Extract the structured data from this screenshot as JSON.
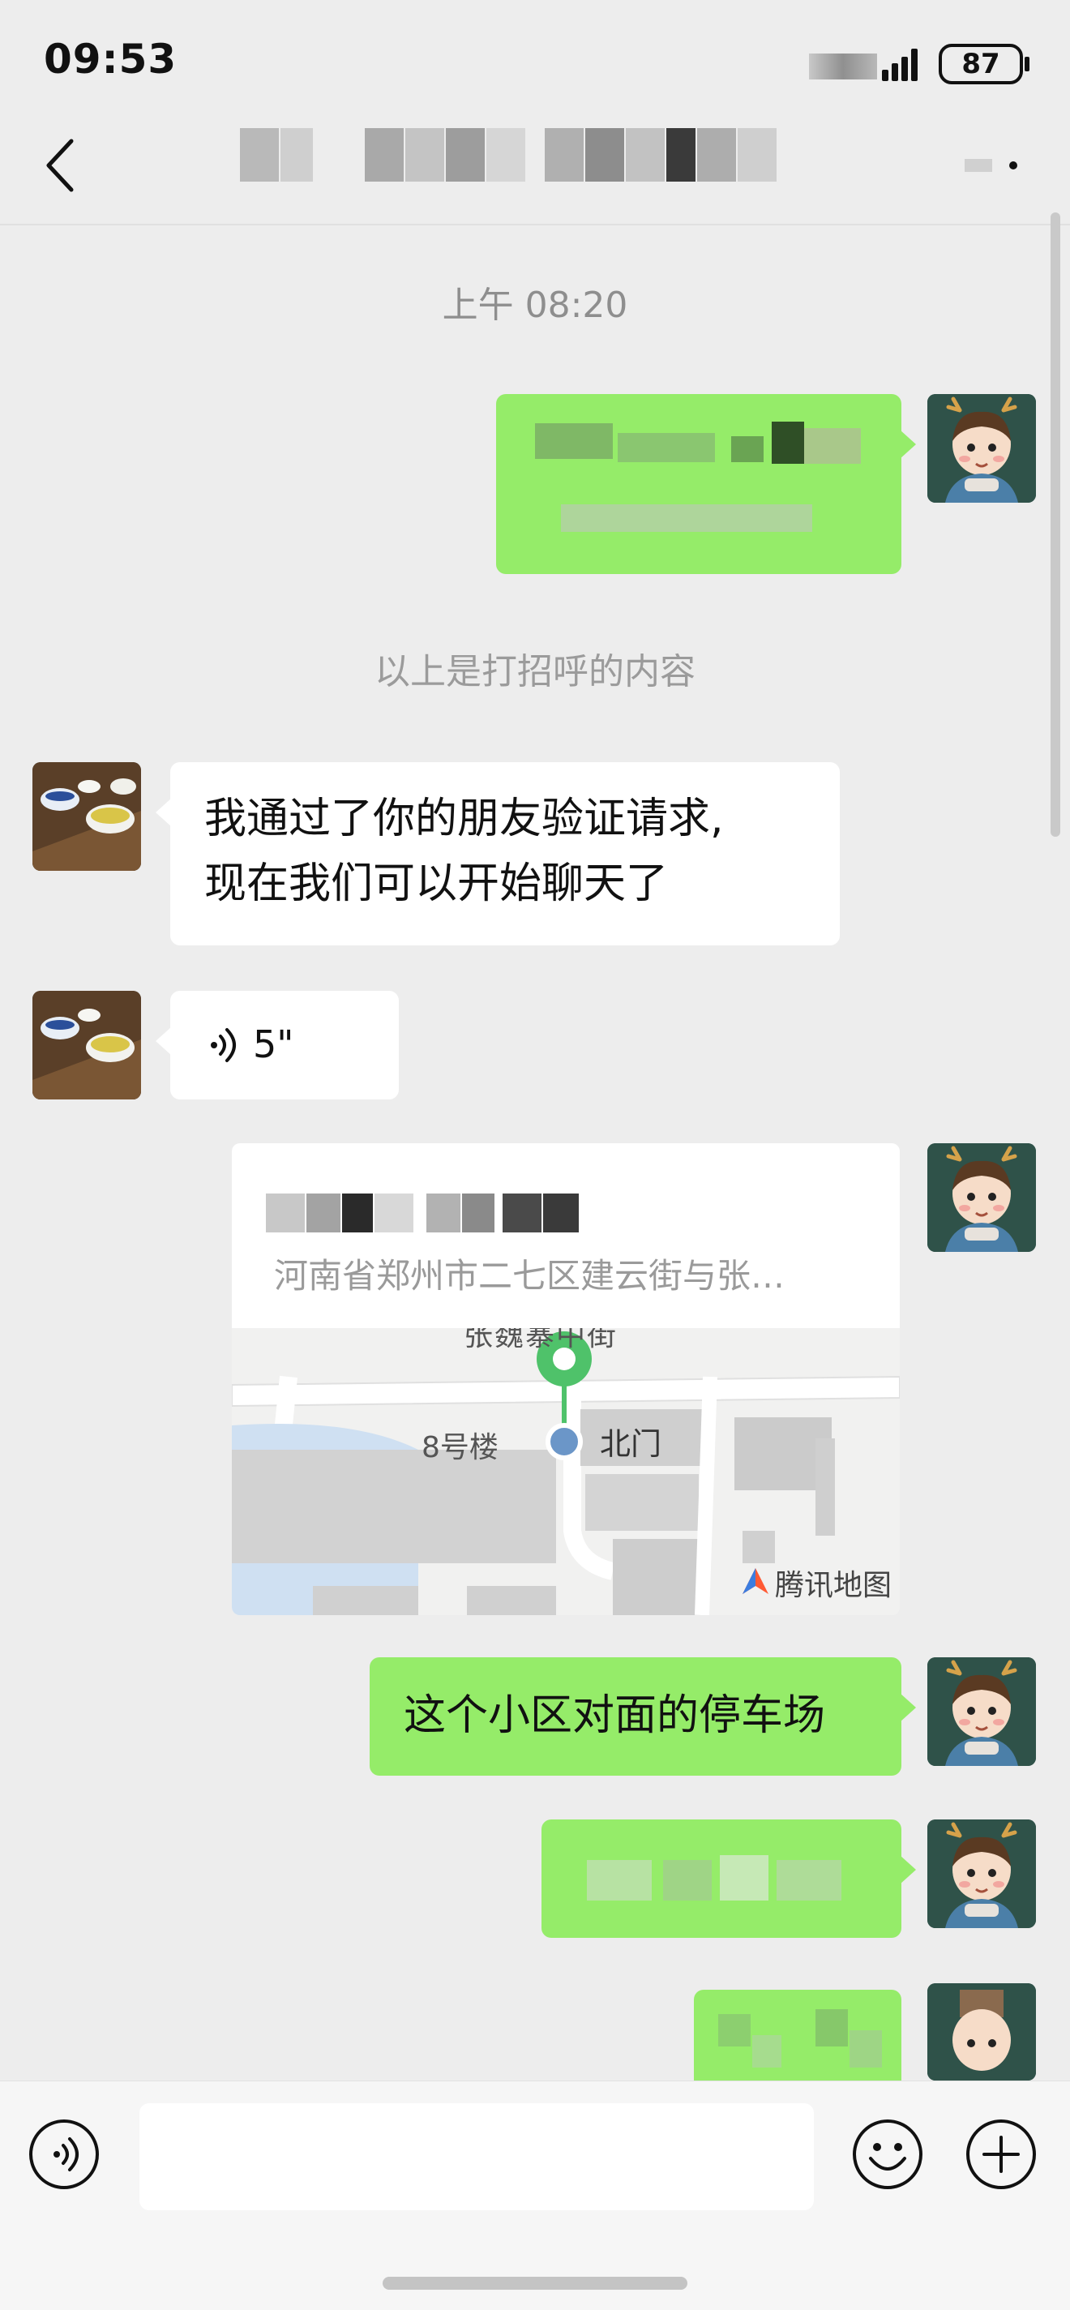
{
  "status_bar": {
    "time": "09:53",
    "battery": "87"
  },
  "chat": {
    "timestamp": "上午 08:20",
    "system_note": "以上是打招呼的内容",
    "messages": {
      "friend_text_line1": "我通过了你的朋友验证请求,",
      "friend_text_line2": "现在我们可以开始聊天了",
      "friend_voice_duration": "5\"",
      "location_address": "河南省郑州市二七区建云街与张…",
      "map_labels": {
        "street": "张魏寨中街",
        "building": "8号楼",
        "poi": "北门",
        "provider": "腾讯地图"
      },
      "my_text": "这个小区对面的停车场"
    }
  },
  "colors": {
    "background": "#ededed",
    "bubble_out": "#95ec69",
    "bubble_in": "#ffffff",
    "map_pin": "#4fc26a",
    "timestamp": "#8e8e8e"
  }
}
